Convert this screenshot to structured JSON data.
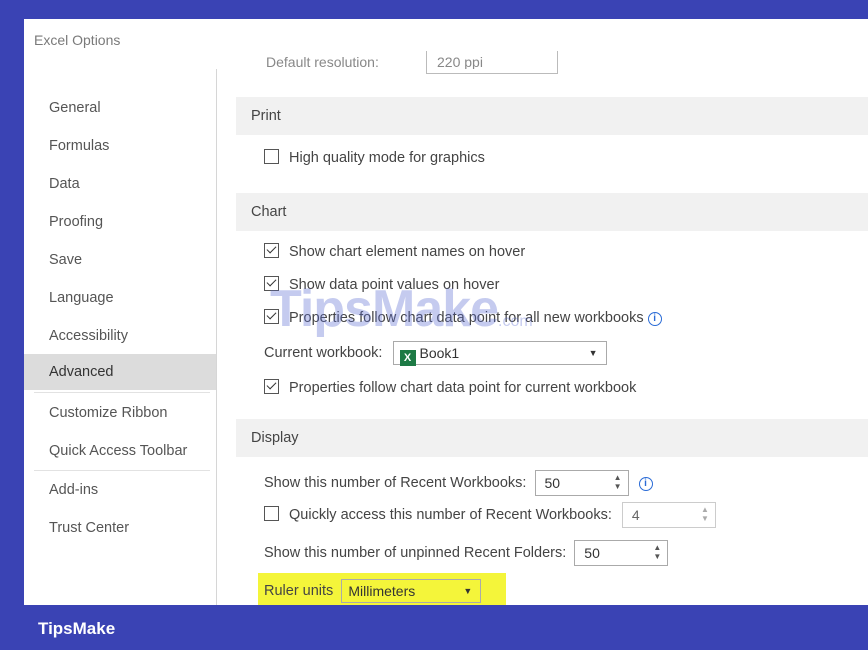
{
  "window": {
    "title": "Excel Options"
  },
  "sidebar": {
    "items": [
      {
        "label": "General"
      },
      {
        "label": "Formulas"
      },
      {
        "label": "Data"
      },
      {
        "label": "Proofing"
      },
      {
        "label": "Save"
      },
      {
        "label": "Language"
      },
      {
        "label": "Accessibility"
      },
      {
        "label": "Advanced",
        "active": true
      },
      {
        "label": "Customize Ribbon"
      },
      {
        "label": "Quick Access Toolbar"
      },
      {
        "label": "Add-ins"
      },
      {
        "label": "Trust Center"
      }
    ]
  },
  "clipped_row": {
    "label": "Default resolution:",
    "value": "220 ppi"
  },
  "print": {
    "header": "Print",
    "high_quality_label": "High quality mode for graphics",
    "high_quality_checked": false
  },
  "chart": {
    "header": "Chart",
    "show_element_names_label": "Show chart element names on hover",
    "show_element_names_checked": true,
    "show_data_values_label": "Show data point values on hover",
    "show_data_values_checked": true,
    "props_all_label": "Properties follow chart data point for all new workbooks",
    "props_all_checked": true,
    "current_workbook_label": "Current workbook:",
    "current_workbook_value": "Book1",
    "props_current_label": "Properties follow chart data point for current workbook",
    "props_current_checked": true
  },
  "display": {
    "header": "Display",
    "recent_workbooks_label": "Show this number of Recent Workbooks:",
    "recent_workbooks_value": "50",
    "quick_access_label": "Quickly access this number of Recent Workbooks:",
    "quick_access_value": "4",
    "quick_access_checked": false,
    "recent_folders_label": "Show this number of unpinned Recent Folders:",
    "recent_folders_value": "50",
    "ruler_units_label": "Ruler units",
    "ruler_units_value": "Millimeters"
  },
  "watermark": {
    "text": "TipsMake",
    "suffix": ".com"
  },
  "footer": {
    "label": "TipsMake"
  },
  "colors": {
    "frame": "#3a43b4",
    "highlight": "#f4f53a",
    "excel_green": "#1d7a45",
    "info_blue": "#2a6bd6"
  },
  "icons": [
    "checkbox-icon",
    "info-icon",
    "excel-workbook-icon",
    "dropdown-arrow-icon",
    "spinner-arrows-icon"
  ]
}
